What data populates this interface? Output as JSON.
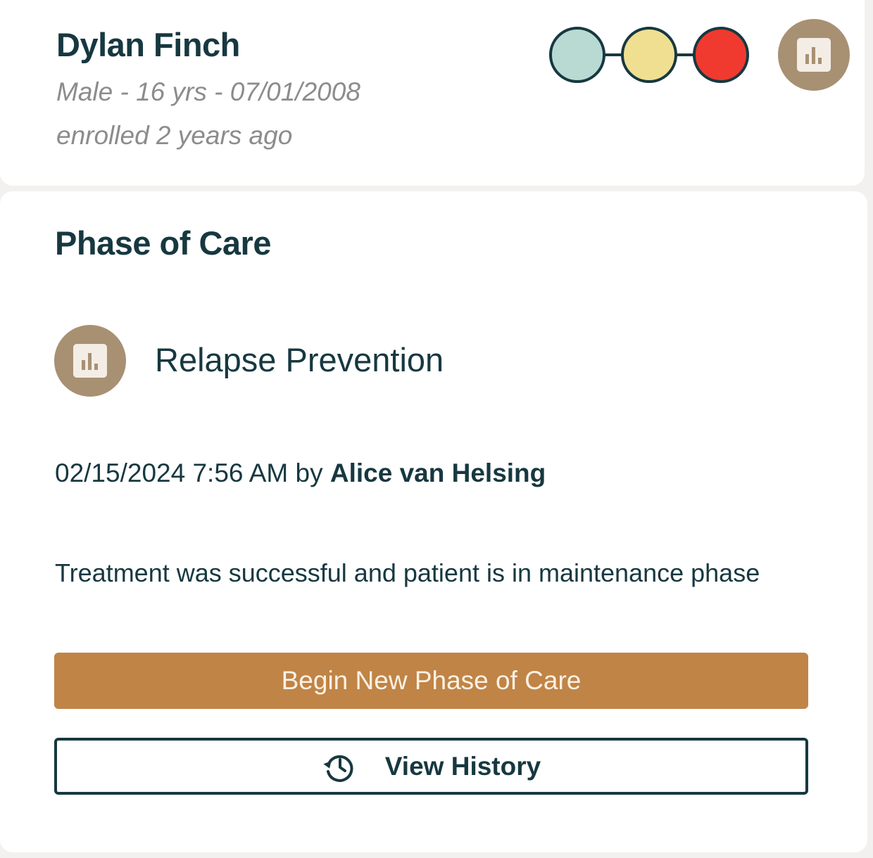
{
  "patient": {
    "name": "Dylan Finch",
    "demographics": "Male - 16 yrs - 07/01/2008",
    "enrolled": "enrolled 2 years ago",
    "status_colors": [
      "#b8dad3",
      "#f0df91",
      "#f03a2f"
    ],
    "badge_icon": "bar-chart-icon"
  },
  "phase_of_care": {
    "title": "Phase of Care",
    "phase_icon": "bar-chart-icon",
    "phase_name": "Relapse Prevention",
    "timestamp": "02/15/2024 7:56 AM",
    "by_label": "by",
    "author": "Alice van Helsing",
    "note": "Treatment was successful and patient is in maintenance phase",
    "begin_button_label": "Begin New Phase of Care",
    "history_button_label": "View History",
    "history_icon": "history-icon"
  },
  "colors": {
    "primary_text": "#173840",
    "accent_button": "#c08446",
    "badge": "#a89073"
  }
}
